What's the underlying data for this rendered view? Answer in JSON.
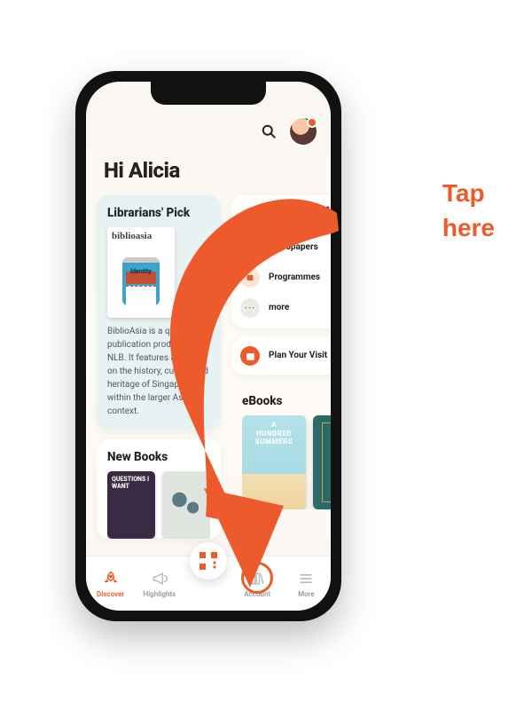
{
  "callout": {
    "line1": "Tap",
    "line2": "here"
  },
  "greeting": "Hi Alicia",
  "pick": {
    "title": "Librarians' Pick",
    "book_brand_a": "biblio",
    "book_brand_b": "asia",
    "cover_word": "Identity",
    "description": "BiblioAsia is a quarterly publication produced by NLB. It features articles on the history, culture and heritage of Singapore within the larger Asian context."
  },
  "menu": {
    "item1": "eNewspapers & eMagazines",
    "item2": "Newspapers",
    "item3": "Programmes",
    "item4": "more"
  },
  "visit": {
    "label": "Plan Your Visit"
  },
  "shelf": {
    "title": "eBooks",
    "book1_title": "A\nHUNDRED\nSUMMERS"
  },
  "newbooks": {
    "title": "New Books",
    "book1_title": "QUESTIONS I WANT"
  },
  "tabs": {
    "t1": "Discover",
    "t2": "Highlights",
    "t3": "",
    "t4": "Account",
    "t5": "More"
  }
}
